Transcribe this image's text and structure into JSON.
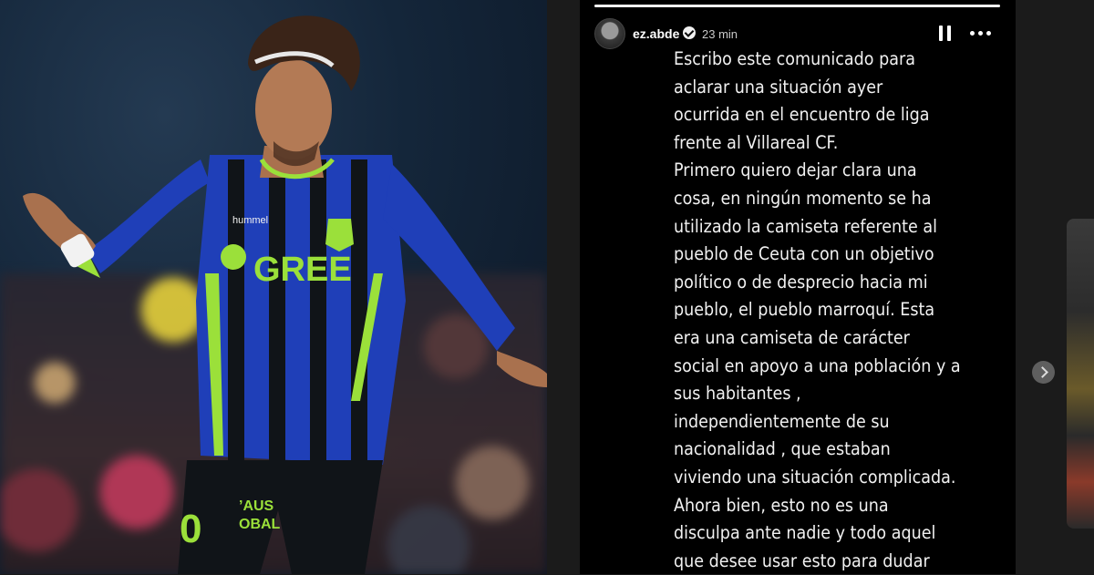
{
  "story": {
    "username": "ez.abde",
    "time": "23 min",
    "progress": 1.0,
    "lines": [
      "Escribo este comunicado para",
      "aclarar una situación ayer",
      "ocurrida en el encuentro de liga",
      "frente al Villareal CF.",
      "Primero quiero dejar clara una",
      "cosa, en ningún momento se ha",
      "utilizado la camiseta referente al",
      "pueblo de Ceuta con un objetivo",
      "político o de desprecio hacia mi",
      "pueblo, el pueblo marroquí. Esta",
      "era una camiseta de carácter",
      "social en apoyo a una población y a",
      "sus habitantes ,",
      "independientemente de su",
      "nacionalidad , que estaban",
      "viviendo una situación complicada.",
      "Ahora bien, esto no es una",
      "disculpa ante nadie y todo aquel",
      "que desee usar esto para dudar"
    ]
  },
  "photo": {
    "sponsor": "GREE",
    "kit_brand": "hummel",
    "shorts_sponsor_line1": "’AUS",
    "shorts_sponsor_line2": "OBAL",
    "shorts_number": "0",
    "colors": {
      "kit_blue": "#1f3fb8",
      "kit_black": "#101418",
      "kit_green": "#9be03a"
    }
  },
  "icons": [
    "verified-icon",
    "pause-icon",
    "more-icon",
    "chevron-right-icon"
  ]
}
